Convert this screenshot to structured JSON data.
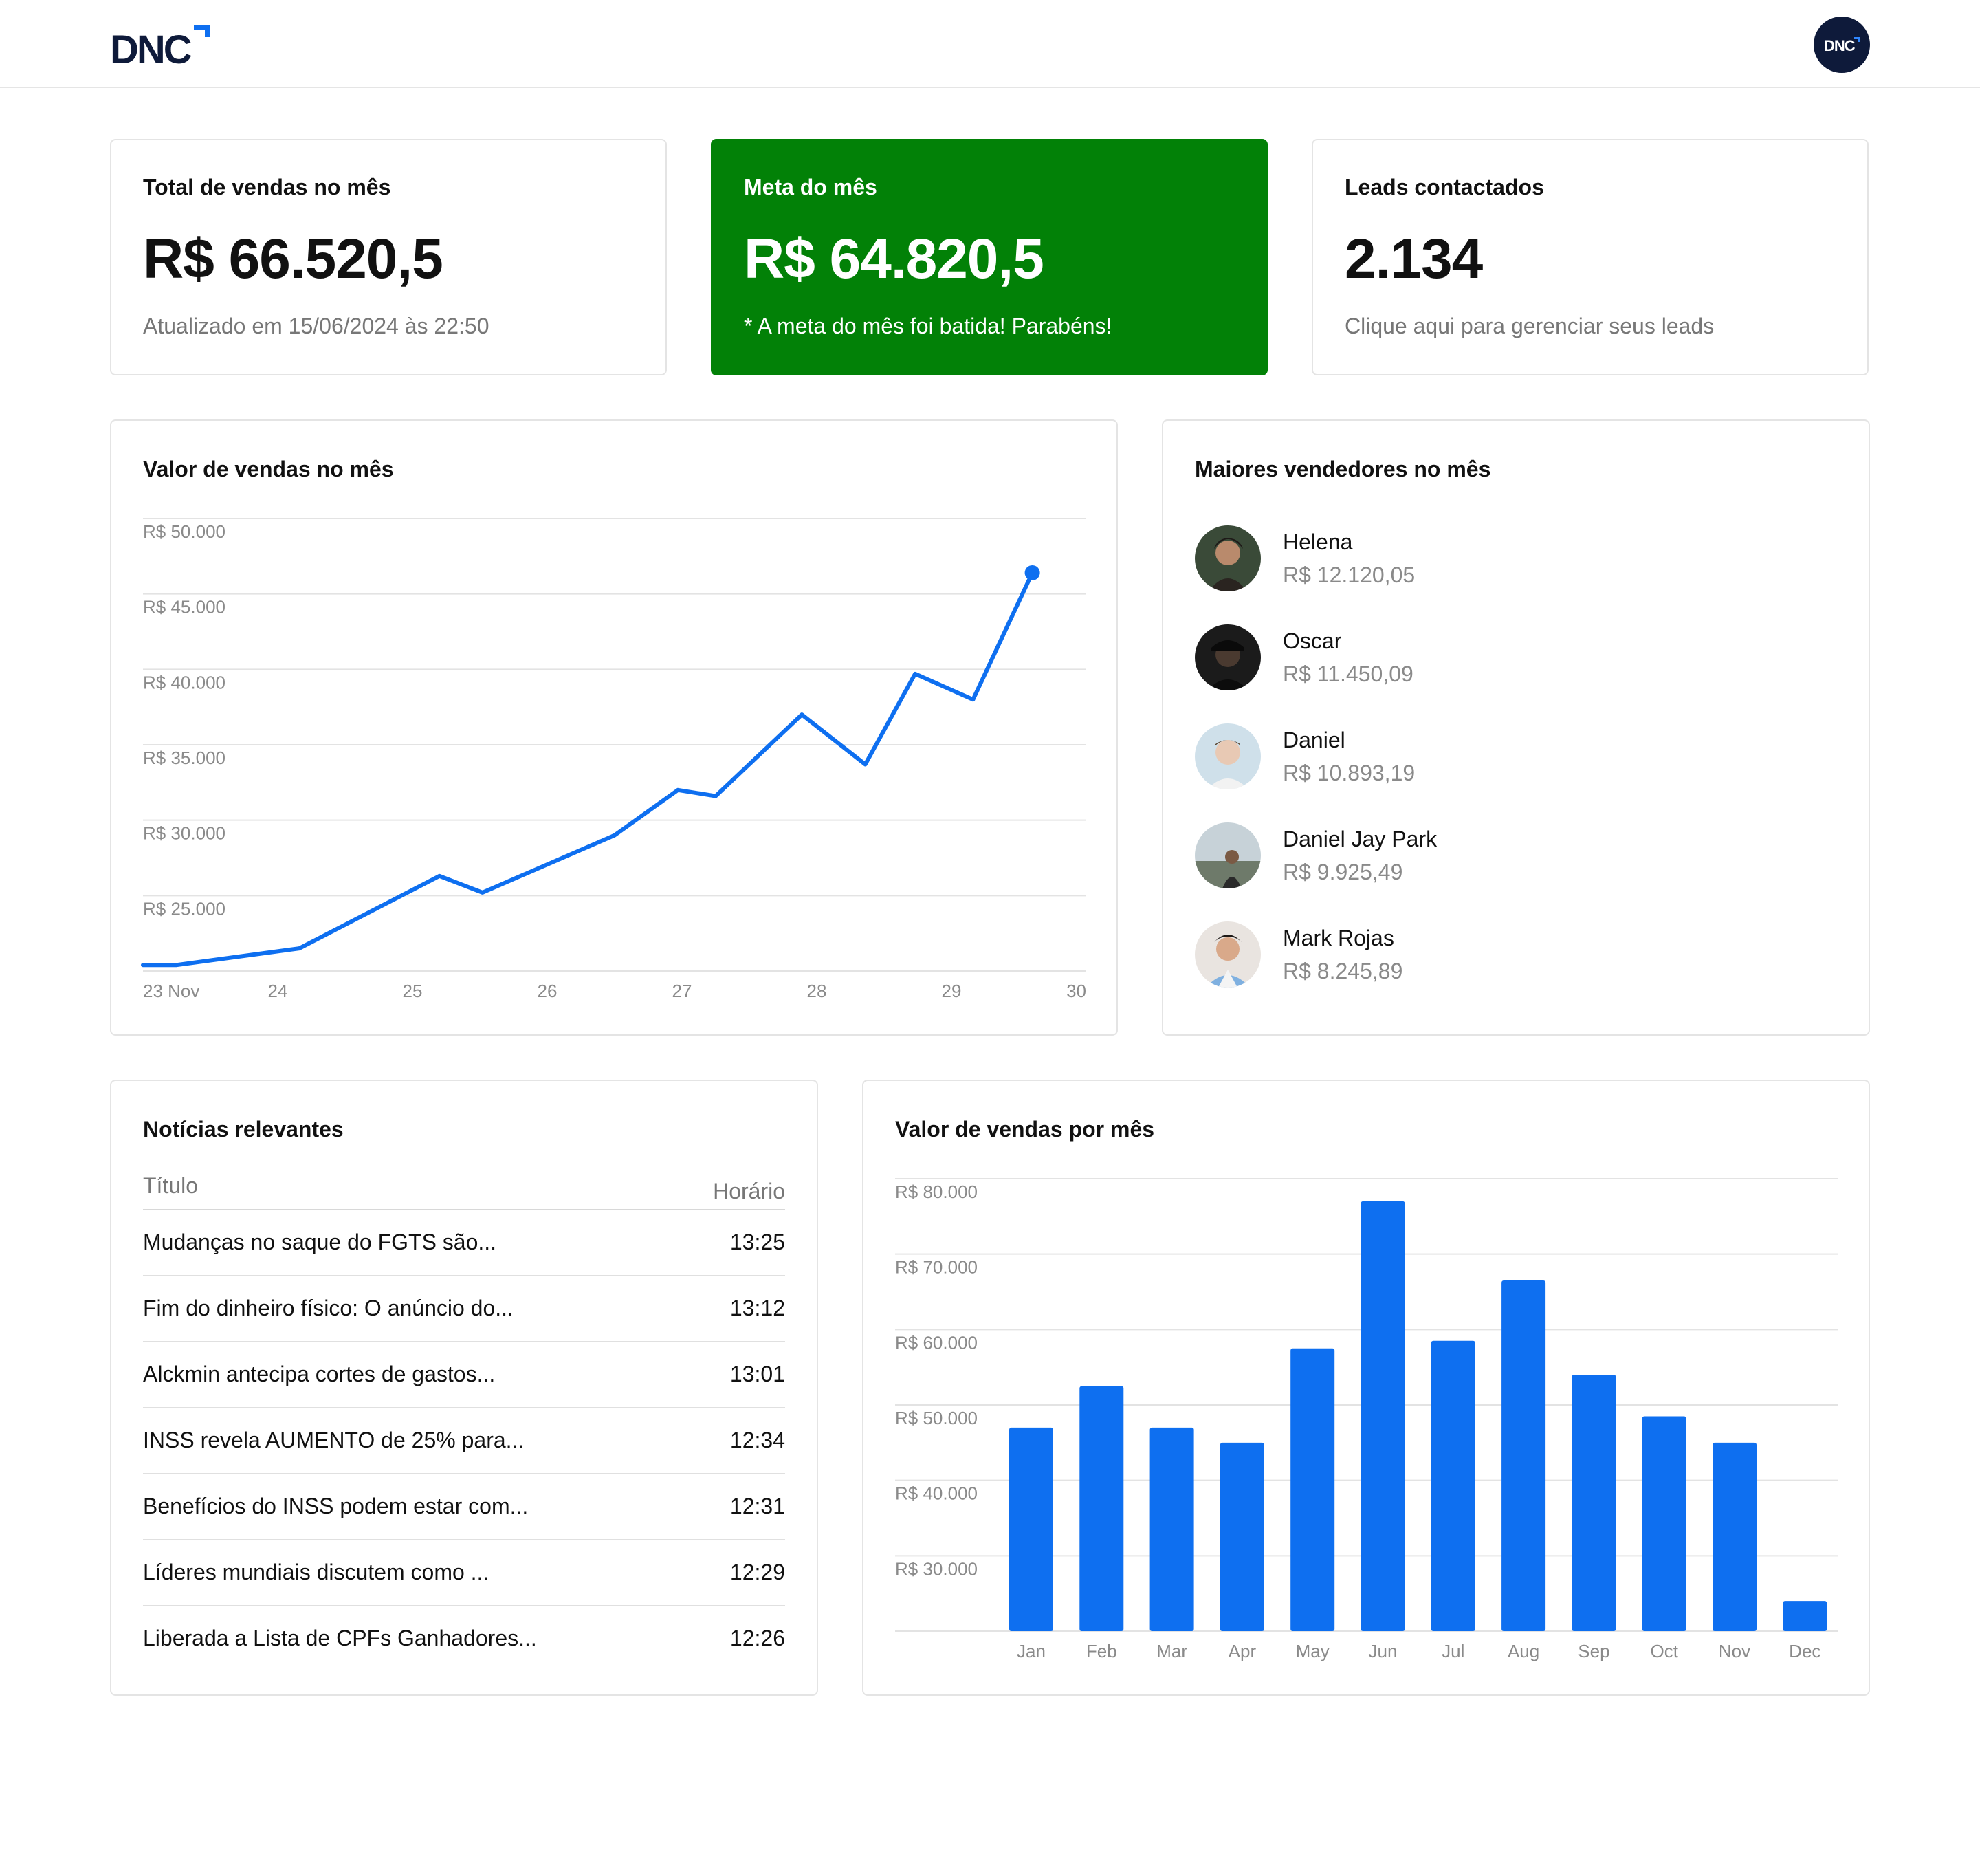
{
  "header": {
    "logo_text": "DNC",
    "avatar_label": "DNC"
  },
  "kpis": [
    {
      "title": "Total de vendas no mês",
      "value": "R$ 66.520,5",
      "note": "Atualizado em 15/06/2024 às 22:50"
    },
    {
      "title": "Meta do mês",
      "value": "R$ 64.820,5",
      "note": "* A meta do mês foi batida! Parabéns!",
      "bg_color": "#028107"
    },
    {
      "title": "Leads contactados",
      "value": "2.134",
      "note": "Clique aqui para gerenciar seus leads"
    }
  ],
  "line_chart": {
    "title": "Valor de vendas no mês"
  },
  "sellers": {
    "title": "Maiores vendedores no mês",
    "items": [
      {
        "name": "Helena",
        "value": "R$ 12.120,05"
      },
      {
        "name": "Oscar",
        "value": "R$ 11.450,09"
      },
      {
        "name": "Daniel",
        "value": "R$ 10.893,19"
      },
      {
        "name": "Daniel Jay Park",
        "value": "R$ 9.925,49"
      },
      {
        "name": "Mark Rojas",
        "value": "R$ 8.245,89"
      }
    ]
  },
  "news": {
    "title": "Notícias relevantes",
    "col_title": "Título",
    "col_time": "Horário",
    "rows": [
      {
        "title": "Mudanças no saque do FGTS são...",
        "time": "13:25"
      },
      {
        "title": "Fim do dinheiro físico: O anúncio do...",
        "time": "13:12"
      },
      {
        "title": "Alckmin antecipa cortes de gastos...",
        "time": "13:01"
      },
      {
        "title": "INSS revela AUMENTO de 25% para...",
        "time": "12:34"
      },
      {
        "title": "Benefícios do INSS podem estar com...",
        "time": "12:31"
      },
      {
        "title": "Líderes mundiais discutem como ...",
        "time": "12:29"
      },
      {
        "title": "Liberada a Lista de CPFs Ganhadores...",
        "time": "12:26"
      }
    ]
  },
  "bar_chart": {
    "title": "Valor de vendas por mês"
  },
  "colors": {
    "accent": "#0e6ff0",
    "success": "#028107",
    "muted_text": "#8a8a8a"
  },
  "chart_data": [
    {
      "type": "line",
      "title": "Valor de vendas no mês",
      "x_ticks": [
        "23 Nov",
        "24",
        "25",
        "26",
        "27",
        "28",
        "29",
        "30"
      ],
      "x": [
        23.0,
        23.25,
        24.16,
        25.2,
        25.52,
        26.5,
        26.97,
        27.25,
        27.89,
        28.36,
        28.73,
        29.16,
        29.6
      ],
      "y": [
        20400,
        20400,
        21500,
        26300,
        25200,
        29000,
        32000,
        31600,
        37000,
        33700,
        39700,
        38000,
        46400
      ],
      "ylim": [
        20000,
        50000
      ],
      "y_ticks": [
        "R$ 50.000",
        "R$ 45.000",
        "R$ 40.000",
        "R$ 35.000",
        "R$ 30.000",
        "R$ 25.000"
      ],
      "y_tick_values": [
        50000,
        45000,
        40000,
        35000,
        30000,
        25000
      ],
      "grid": true,
      "color": "#0e6ff0"
    },
    {
      "type": "bar",
      "title": "Valor de vendas por mês",
      "categories": [
        "Jan",
        "Feb",
        "Mar",
        "Apr",
        "May",
        "Jun",
        "Jul",
        "Aug",
        "Sep",
        "Oct",
        "Nov",
        "Dec"
      ],
      "values": [
        47000,
        52500,
        47000,
        45000,
        57500,
        77000,
        58500,
        66500,
        54000,
        48500,
        45000,
        24000
      ],
      "ylim": [
        20000,
        80000
      ],
      "y_ticks": [
        "R$ 80.000",
        "R$ 70.000",
        "R$ 60.000",
        "R$ 50.000",
        "R$ 40.000",
        "R$ 30.000"
      ],
      "y_tick_values": [
        80000,
        70000,
        60000,
        50000,
        40000,
        30000
      ],
      "grid": true,
      "color": "#0e6ff0"
    }
  ]
}
